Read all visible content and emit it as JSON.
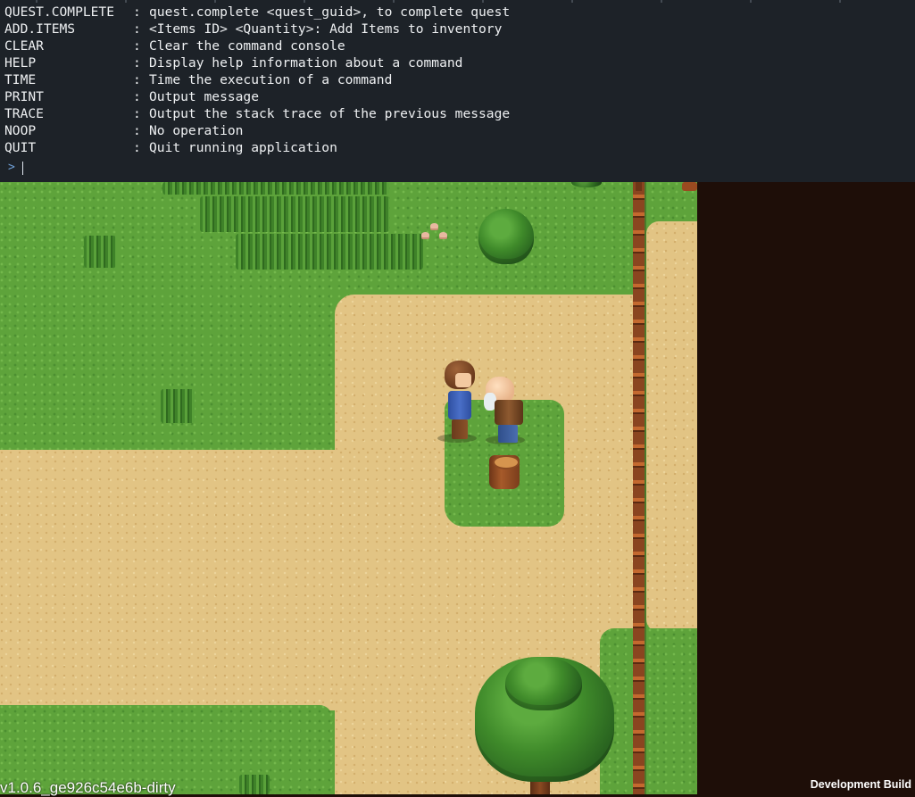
{
  "console": {
    "commands": [
      {
        "name": "QUEST.COMPLETE",
        "desc": "quest.complete <quest_guid>, to complete quest"
      },
      {
        "name": "ADD.ITEMS",
        "desc": "<Items ID> <Quantity>: Add Items to inventory"
      },
      {
        "name": "CLEAR",
        "desc": "Clear the command console"
      },
      {
        "name": "HELP",
        "desc": "Display help information about a command"
      },
      {
        "name": "TIME",
        "desc": "Time the execution of a command"
      },
      {
        "name": "PRINT",
        "desc": "Output message"
      },
      {
        "name": "TRACE",
        "desc": "Output the stack trace of the previous message"
      },
      {
        "name": "NOOP",
        "desc": "No operation"
      },
      {
        "name": "QUIT",
        "desc": "Quit running application"
      }
    ],
    "separator": ":",
    "prompt_symbol": ">",
    "input_value": "",
    "colors": {
      "background": "#1d2228",
      "text": "#eef0f2",
      "prompt": "#6f9fd6"
    }
  },
  "hud": {
    "version": "v1.0.6_ge926c54e6b-dirty",
    "build_label": "Development Build"
  },
  "scene": {
    "colors": {
      "grass": "#5ea33b",
      "dirt": "#e2c484",
      "fence": "#c4692f",
      "letterbox": "#1e0e08"
    },
    "objects": [
      "player-character",
      "bald-npc",
      "tree-stump",
      "pine-tree",
      "large-tree",
      "wooden-fence",
      "mushrooms",
      "tall-grass-patch"
    ]
  }
}
